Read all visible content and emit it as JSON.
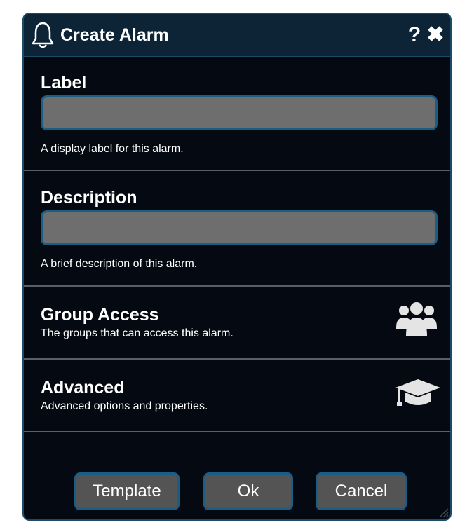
{
  "dialog": {
    "title": "Create Alarm",
    "icons": {
      "title": "bell-icon",
      "help": "?",
      "close": "✖"
    }
  },
  "label_section": {
    "label": "Label",
    "value": "",
    "help": "A display label for this alarm."
  },
  "description_section": {
    "label": "Description",
    "value": "",
    "help": "A brief description of this alarm."
  },
  "group_access": {
    "title": "Group Access",
    "subtitle": "The groups that can access this alarm.",
    "icon": "users-icon"
  },
  "advanced": {
    "title": "Advanced",
    "subtitle": "Advanced options and properties.",
    "icon": "graduation-cap-icon"
  },
  "buttons": {
    "template": "Template",
    "ok": "Ok",
    "cancel": "Cancel"
  },
  "colors": {
    "background": "#050a12",
    "titlebar": "#0d2436",
    "field": "#6e6e6e",
    "accent_border": "#1a5e86",
    "button": "#545454"
  }
}
